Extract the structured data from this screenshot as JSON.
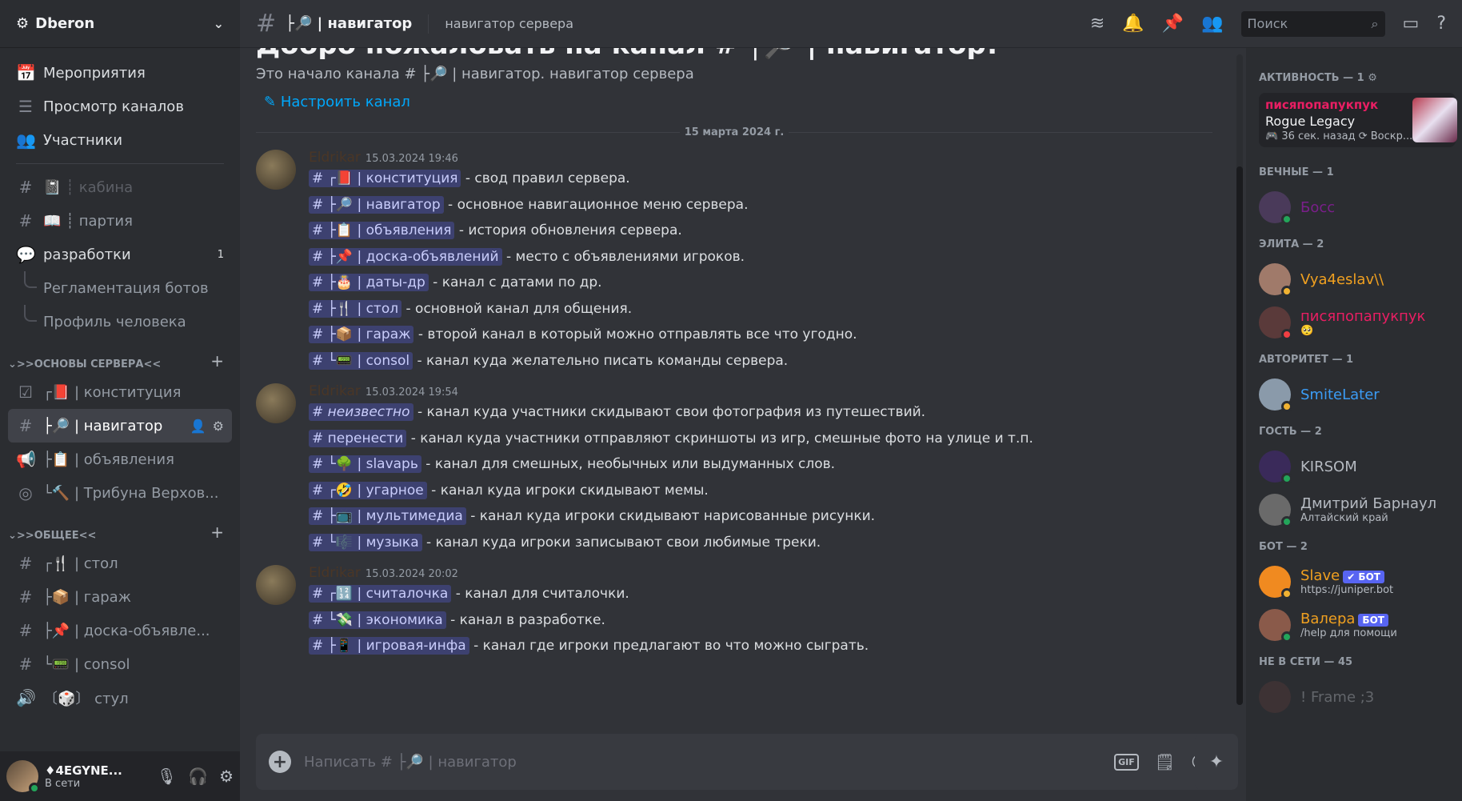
{
  "server": {
    "name": "Dberon"
  },
  "sidebar": {
    "top_items": [
      {
        "icon": "calendar-icon",
        "glyph": "📅",
        "label": "Мероприятия"
      },
      {
        "icon": "browse-channels-icon",
        "glyph": "☰",
        "label": "Просмотр каналов"
      },
      {
        "icon": "members-icon",
        "glyph": "👥",
        "label": "Участники"
      }
    ],
    "channels_a": [
      {
        "glyph": "#",
        "label": "📓 ┊ кабина",
        "style": "muted"
      },
      {
        "glyph": "#",
        "label": "📖 ┊ партия",
        "style": "normal"
      },
      {
        "glyph": "💬",
        "label": "разработки",
        "style": "bright",
        "badge": "1"
      }
    ],
    "threads": [
      "Регламентация ботов",
      "Профиль человека"
    ],
    "category1": {
      "name": ">>ОСНОВЫ СЕРВЕРА<<"
    },
    "channels_b": [
      {
        "glyph": "☑",
        "label": "┌📕 | конституция",
        "active": false
      },
      {
        "glyph": "#",
        "label": "├🔎 | навигатор",
        "active": true
      },
      {
        "glyph": "📢",
        "label": "├📋 | объявления",
        "active": false
      },
      {
        "glyph": "◎",
        "label": "└🔨 | Трибуна Верхов...",
        "active": false
      }
    ],
    "category2": {
      "name": ">>ОБЩЕЕ<<"
    },
    "channels_c": [
      {
        "glyph": "#",
        "label": "┌🍴 | стол"
      },
      {
        "glyph": "#",
        "label": "├📦 | гараж"
      },
      {
        "glyph": "#",
        "label": "├📌 | доска-объявле..."
      },
      {
        "glyph": "#",
        "label": "└📟 | consol"
      },
      {
        "glyph": "🔊",
        "label": "〔🎲〕 стул"
      }
    ]
  },
  "user": {
    "name": "♦4EGYNE...",
    "status": "В сети"
  },
  "topbar": {
    "channel": "├🔎 | навигатор",
    "topic": "навигатор сервера",
    "search_placeholder": "Поиск"
  },
  "welcome": {
    "title": "Добро пожаловать на канал # ├🔎 | навигатор!",
    "start": "Это начало канала # ├🔎 | навигатор. навигатор сервера",
    "setup": "Настроить канал",
    "date": "15 марта 2024 г."
  },
  "messages": [
    {
      "author": "Eldrikar",
      "time": "15.03.2024 19:46",
      "lines": [
        {
          "ch": "#  ┌📕 | конституция",
          "text": " - свод правил сервера."
        },
        {
          "ch": "#  ├🔎 | навигатор",
          "text": " - основное навигационное меню сервера."
        },
        {
          "ch": "#  ├📋 | объявления",
          "text": " - история обновления сервера."
        },
        {
          "ch": "#  ├📌 | доска-объявлений",
          "text": " - место с объявлениями игроков."
        },
        {
          "ch": "#  ├🎂 | даты-др",
          "text": " - канал с датами по др."
        },
        {
          "ch": "#  ├🍴 | стол",
          "text": " - основной канал для общения."
        },
        {
          "ch": "#  ├📦 | гараж",
          "text": " - второй канал в который можно отправлять все что угодно."
        },
        {
          "ch": "#  └📟 | consol",
          "text": " - канал куда желательно писать команды сервера."
        }
      ]
    },
    {
      "author": "Eldrikar",
      "time": "15.03.2024 19:54",
      "lines": [
        {
          "ch": "# неизвестно",
          "text": " - канал куда участники скидывают свои фотография из путешествий.",
          "italic": true
        },
        {
          "ch": "# перенести",
          "text": " - канал куда участники отправляют скриншоты из игр, смешные фото на улице и т.п."
        },
        {
          "ch": "#  └🌳 | slavapь",
          "text": " - канал для смешных, необычных или выдуманных слов."
        },
        {
          "ch": "#  ┌🤣 | угарное",
          "text": " - канал куда игроки скидывают мемы."
        },
        {
          "ch": "#  ├📺 | мультимедиа",
          "text": " - канал куда игроки скидывают нарисованные рисунки."
        },
        {
          "ch": "#  └🎼 | музыка",
          "text": " - канал куда игроки записывают свои любимые треки."
        }
      ]
    },
    {
      "author": "Eldrikar",
      "time": "15.03.2024 20:02",
      "lines": [
        {
          "ch": "#  ┌🔢 | считалочка",
          "text": " - канал для считалочки."
        },
        {
          "ch": "#  └💸 | экономика",
          "text": " - канал в разработке."
        },
        {
          "ch": "#  ├📱 | игровая-инфа",
          "text": " - канал где игроки предлагают во что можно сыграть."
        }
      ]
    }
  ],
  "composer": {
    "placeholder": "Написать # ├🔎 | навигатор",
    "gif": "GIF"
  },
  "members": {
    "activity_header": "АКТИВНОСТЬ — 1 ⚙",
    "activity": {
      "who": "писяпопапукпук",
      "game": "Rogue Legacy",
      "meta": "🎮 36 сек. назад  ⟳ Воскр..."
    },
    "groups": [
      {
        "name": "ВЕЧНЫЕ — 1",
        "members": [
          {
            "name": "Босс",
            "color": "#7a1f8a",
            "status": "#23a55a",
            "av": "#4a3a5a"
          }
        ]
      },
      {
        "name": "ЭЛИТА — 2",
        "members": [
          {
            "name": "Vya4eslav\\\\",
            "color": "#f0a020",
            "status": "#f0b232",
            "av": "#a07a6a"
          },
          {
            "name": "писяпопапукпук",
            "color": "#e91e63",
            "status": "#f23f43",
            "av": "#5a3a3a",
            "sub": "🥺"
          }
        ]
      },
      {
        "name": "АВТОРИТЕТ — 1",
        "members": [
          {
            "name": "SmiteLater",
            "color": "#3b9cf5",
            "status": "#f0b232",
            "av": "#8a9aaa"
          }
        ]
      },
      {
        "name": "ГОСТЬ — 2",
        "members": [
          {
            "name": "KIRSOM",
            "color": "#b5bac1",
            "status": "#23a55a",
            "av": "#3a2a5a"
          },
          {
            "name": "Дмитрий Барнаул",
            "color": "#b5bac1",
            "status": "#23a55a",
            "av": "#6a6a6a",
            "sub": "Алтайский край"
          }
        ]
      },
      {
        "name": "БОТ — 2",
        "members": [
          {
            "name": "Slave",
            "color": "#f0a020",
            "status": "#f0b232",
            "av": "#f08a20",
            "sub": "https://juniper.bot",
            "bot": "✔ БОТ"
          },
          {
            "name": "Валера",
            "color": "#f0a020",
            "status": "#23a55a",
            "av": "#8a5a4a",
            "sub": "/help для помощи",
            "bot": "БОТ"
          }
        ]
      },
      {
        "name": "НЕ В СЕТИ — 45",
        "members": [
          {
            "name": "! Frame ;3",
            "color": "#b5bac1",
            "status": "",
            "av": "#5a3a3a",
            "offline": true
          }
        ]
      }
    ]
  }
}
